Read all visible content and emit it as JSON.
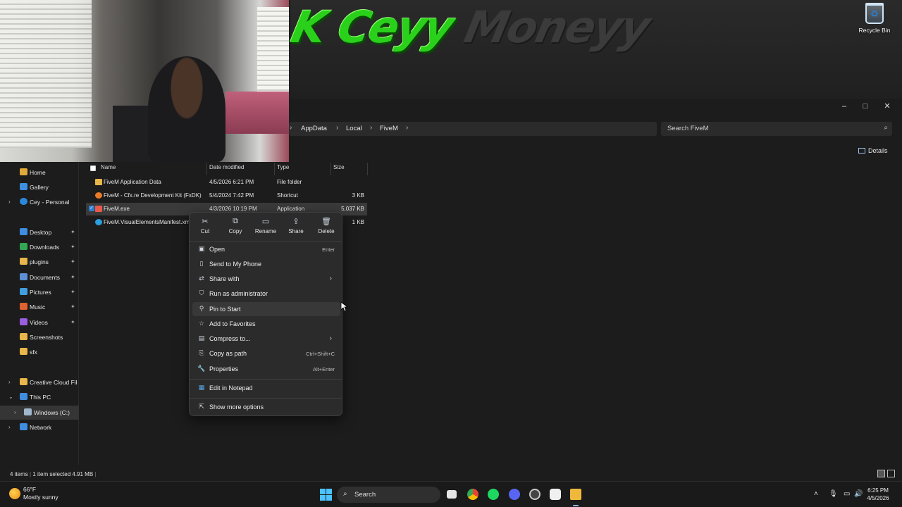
{
  "desktop": {
    "banner_text_main": "K Ceyy",
    "banner_text_faded": "Moneyy",
    "recycle_bin_label": "Recycle Bin"
  },
  "explorer": {
    "breadcrumb": [
      "AppData",
      "Local",
      "FiveM"
    ],
    "search_placeholder": "Search FiveM",
    "details_label": "Details",
    "window_controls": {
      "minimize": "–",
      "maximize": "□",
      "close": "✕"
    },
    "sidebar": [
      {
        "label": "Home",
        "icon": "home-icon",
        "color": "#e0a93b",
        "pinned": false
      },
      {
        "label": "Gallery",
        "icon": "gallery-icon",
        "color": "#3d8fe0",
        "pinned": false
      },
      {
        "label": "Cey - Personal",
        "icon": "cloud-icon",
        "color": "#2b88d8",
        "pinned": false,
        "expandable": true
      },
      {
        "label": "Desktop",
        "icon": "desktop-icon",
        "color": "#3f8de0",
        "pinned": true
      },
      {
        "label": "Downloads",
        "icon": "download-icon",
        "color": "#32a852",
        "pinned": true
      },
      {
        "label": "plugins",
        "icon": "folder-icon",
        "color": "#e8b64a",
        "pinned": true
      },
      {
        "label": "Documents",
        "icon": "documents-icon",
        "color": "#5d8fd6",
        "pinned": true
      },
      {
        "label": "Pictures",
        "icon": "pictures-icon",
        "color": "#3f9fe0",
        "pinned": true
      },
      {
        "label": "Music",
        "icon": "music-icon",
        "color": "#e0622f",
        "pinned": true
      },
      {
        "label": "Videos",
        "icon": "videos-icon",
        "color": "#9a5ee0",
        "pinned": true
      },
      {
        "label": "Screenshots",
        "icon": "folder-icon",
        "color": "#e8b64a",
        "pinned": false
      },
      {
        "label": "sfx",
        "icon": "folder-icon",
        "color": "#e8b64a",
        "pinned": false
      },
      {
        "label": "Creative Cloud Files",
        "icon": "folder-icon",
        "color": "#e8b64a",
        "pinned": false,
        "expandable": true
      },
      {
        "label": "This PC",
        "icon": "pc-icon",
        "color": "#3f8de0",
        "pinned": false,
        "expanded": true
      },
      {
        "label": "Windows (C:)",
        "icon": "drive-icon",
        "color": "#9fb6cc",
        "pinned": false,
        "expandable": true,
        "selected": true
      },
      {
        "label": "Network",
        "icon": "network-icon",
        "color": "#3f8de0",
        "pinned": false,
        "expandable": true
      }
    ],
    "columns": {
      "name": "Name",
      "date": "Date modified",
      "type": "Type",
      "size": "Size"
    },
    "files": [
      {
        "name": "FiveM Application Data",
        "date": "4/5/2026 6:21 PM",
        "type": "File folder",
        "size": "",
        "icon_color": "#e8b64a"
      },
      {
        "name": "FiveM - Cfx.re Development Kit (FxDK)",
        "date": "5/4/2024 7:42 PM",
        "type": "Shortcut",
        "size": "3 KB",
        "icon_color": "#e87a2a"
      },
      {
        "name": "FiveM.exe",
        "date": "4/3/2026 10:19 PM",
        "type": "Application",
        "size": "5,037 KB",
        "icon_color": "#e8594a",
        "selected": true
      },
      {
        "name": "FiveM.VisualElementsManifest.xml",
        "date": "",
        "type": "",
        "size": "1 KB",
        "icon_color": "#2b9fe0"
      }
    ],
    "status": {
      "items": "4 items",
      "selected": "1 item selected  4.91 MB"
    }
  },
  "context_menu": {
    "quick_actions": [
      {
        "label": "Cut",
        "icon": "cut-icon"
      },
      {
        "label": "Copy",
        "icon": "copy-icon"
      },
      {
        "label": "Rename",
        "icon": "rename-icon"
      },
      {
        "label": "Share",
        "icon": "share-icon"
      },
      {
        "label": "Delete",
        "icon": "delete-icon"
      }
    ],
    "items": [
      {
        "label": "Open",
        "shortcut": "Enter",
        "icon": "open-icon"
      },
      {
        "label": "Send to My Phone",
        "shortcut": "",
        "icon": "phone-icon"
      },
      {
        "label": "Share with",
        "shortcut": "",
        "icon": "share-with-icon",
        "submenu": true
      },
      {
        "label": "Run as administrator",
        "shortcut": "",
        "icon": "shield-icon"
      },
      {
        "label": "Pin to Start",
        "shortcut": "",
        "icon": "pin-icon",
        "hover": true
      },
      {
        "label": "Add to Favorites",
        "shortcut": "",
        "icon": "star-icon"
      },
      {
        "label": "Compress to...",
        "shortcut": "",
        "icon": "zip-icon",
        "submenu": true
      },
      {
        "label": "Copy as path",
        "shortcut": "Ctrl+Shift+C",
        "icon": "path-icon"
      },
      {
        "label": "Properties",
        "shortcut": "Alt+Enter",
        "icon": "properties-icon"
      }
    ],
    "extra_items": [
      {
        "label": "Edit in Notepad",
        "icon": "notepad-icon"
      },
      {
        "label": "Show more options",
        "icon": "more-options-icon"
      }
    ]
  },
  "taskbar": {
    "weather_temp": "66°F",
    "weather_desc": "Mostly sunny",
    "search_label": "Search",
    "time": "6:25 PM",
    "date": "4/5/2026"
  }
}
